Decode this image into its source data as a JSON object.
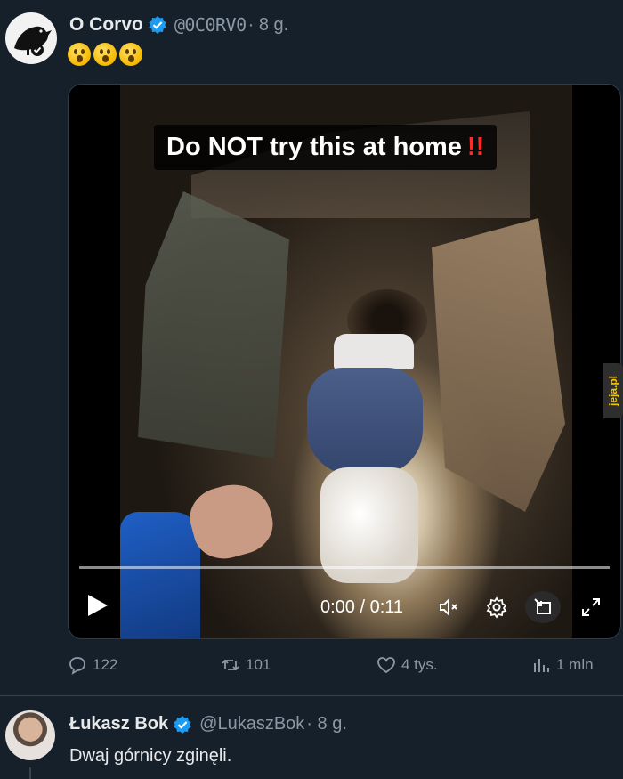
{
  "tweet": {
    "author_name": "O Corvo",
    "handle": "@0C0RV0",
    "time": "· 8 g.",
    "emojis": [
      "astonished-face",
      "astonished-face",
      "astonished-face"
    ],
    "video": {
      "banner_text": "Do NOT try this at home",
      "banner_marks": "!!",
      "time_display": "0:00 / 0:11",
      "progress_fraction": 0.0
    },
    "stats": {
      "replies": "122",
      "reposts": "101",
      "likes": "4 tys.",
      "views": "1 mln"
    }
  },
  "reply": {
    "author_name": "Łukasz Bok",
    "handle": "@LukaszBok",
    "time": "· 8 g.",
    "text": "Dwaj górnicy zginęli."
  },
  "watermark": "jeja.pl",
  "colors": {
    "background": "#15202b",
    "verified": "#1d9bf0",
    "muted_text": "#8b98a5",
    "banner_marks": "#ff2a2a"
  }
}
